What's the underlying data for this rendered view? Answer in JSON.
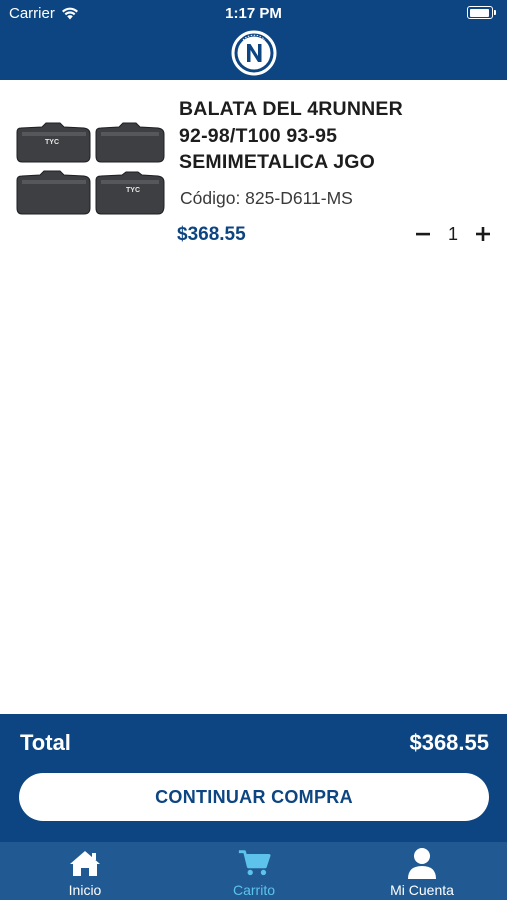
{
  "status_bar": {
    "carrier": "Carrier",
    "time": "1:17 PM"
  },
  "header": {
    "logo_icon": "brand-logo-n"
  },
  "cart": {
    "items": [
      {
        "title_lines": [
          "BALATA DEL 4RUNNER",
          "92-98/T100 93-95",
          "SEMIMETALICA JGO"
        ],
        "code": "Código: 825-D611-MS",
        "price": "$368.55",
        "quantity": "1",
        "image_icon": "brake-pads-image",
        "image_brand": "TYC"
      }
    ]
  },
  "summary": {
    "total_label": "Total",
    "total_value": "$368.55",
    "continue_label": "CONTINUAR COMPRA"
  },
  "tabbar": {
    "tabs": [
      {
        "label": "Inicio",
        "icon": "home-icon",
        "active": false
      },
      {
        "label": "Carrito",
        "icon": "cart-icon",
        "active": true
      },
      {
        "label": "Mi Cuenta",
        "icon": "user-icon",
        "active": false
      }
    ]
  },
  "colors": {
    "primary": "#0d4582",
    "tabbar": "#215a92",
    "active_tab": "#5ec3ea",
    "background": "#ffffff"
  }
}
